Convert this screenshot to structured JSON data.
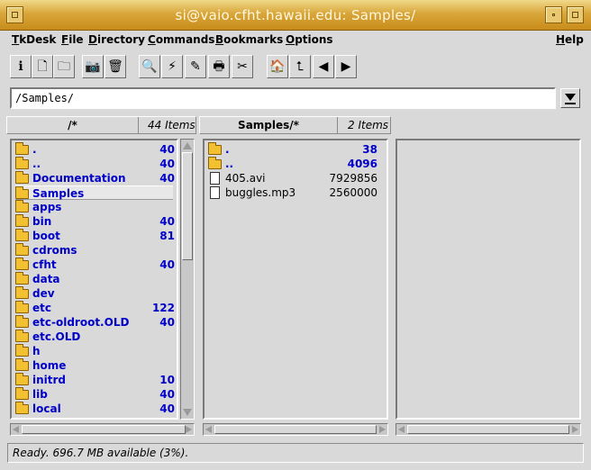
{
  "window": {
    "title": "si@vaio.cfht.hawaii.edu: Samples/"
  },
  "menu": {
    "items": [
      {
        "label": "TkDesk",
        "ul": "T",
        "rest": "kDesk"
      },
      {
        "label": "File",
        "ul": "F",
        "rest": "ile"
      },
      {
        "label": "Directory",
        "ul": "D",
        "rest": "irectory"
      },
      {
        "label": "Commands",
        "ul": "C",
        "rest": "ommands"
      },
      {
        "label": "Bookmarks",
        "ul": "B",
        "rest": "ookmarks"
      },
      {
        "label": "Options",
        "ul": "O",
        "rest": "ptions"
      },
      {
        "label": "Help",
        "ul": "H",
        "rest": "elp"
      }
    ]
  },
  "toolbar": {
    "icons": [
      "info-icon",
      "new-file-icon",
      "new-folder-icon",
      "camera-icon",
      "trash-icon",
      "search-icon",
      "lightning-icon",
      "pencil-icon",
      "print-icon",
      "cut-icon",
      "home-icon",
      "parent-folder-icon",
      "back-arrow-icon",
      "forward-arrow-icon"
    ],
    "glyphs": [
      "ℹ",
      "🗋",
      "🗀",
      "📷",
      "🗑",
      "🔍",
      "⚡",
      "✎",
      "🖶",
      "✂",
      "🏠",
      "⮤",
      "◀",
      "▶"
    ]
  },
  "path": {
    "value": "/Samples/"
  },
  "panels": [
    {
      "name": "/*",
      "count": "44 Items"
    },
    {
      "name": "Samples/*",
      "count": "2 Items"
    }
  ],
  "left_list": [
    {
      "name": ".",
      "size": "40",
      "dir": true
    },
    {
      "name": "..",
      "size": "40",
      "dir": true
    },
    {
      "name": "Documentation",
      "size": "40",
      "dir": true
    },
    {
      "name": "Samples",
      "size": "",
      "dir": true,
      "selected": true
    },
    {
      "name": "apps",
      "size": "",
      "dir": true
    },
    {
      "name": "bin",
      "size": "40",
      "dir": true
    },
    {
      "name": "boot",
      "size": "81",
      "dir": true
    },
    {
      "name": "cdroms",
      "size": "",
      "dir": true
    },
    {
      "name": "cfht",
      "size": "40",
      "dir": true
    },
    {
      "name": "data",
      "size": "",
      "dir": true
    },
    {
      "name": "dev",
      "size": "",
      "dir": true
    },
    {
      "name": "etc",
      "size": "122",
      "dir": true
    },
    {
      "name": "etc-oldroot.OLD",
      "size": "40",
      "dir": true
    },
    {
      "name": "etc.OLD",
      "size": "",
      "dir": true
    },
    {
      "name": "h",
      "size": "",
      "dir": true
    },
    {
      "name": "home",
      "size": "",
      "dir": true
    },
    {
      "name": "initrd",
      "size": "10",
      "dir": true
    },
    {
      "name": "lib",
      "size": "40",
      "dir": true
    },
    {
      "name": "local",
      "size": "40",
      "dir": true
    }
  ],
  "middle_list": [
    {
      "name": ".",
      "size": "38",
      "dir": true
    },
    {
      "name": "..",
      "size": "4096",
      "dir": true
    },
    {
      "name": "405.avi",
      "size": "7929856",
      "dir": false
    },
    {
      "name": "buggles.mp3",
      "size": "2560000",
      "dir": false
    }
  ],
  "status": {
    "text": "Ready.  696.7 MB available (3%)."
  }
}
